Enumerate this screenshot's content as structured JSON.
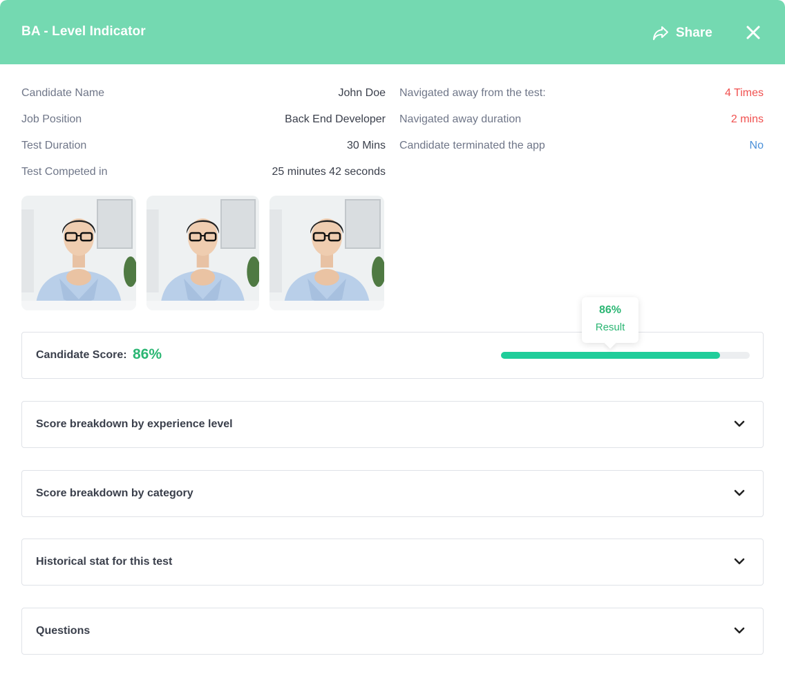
{
  "header": {
    "title": "BA - Level Indicator",
    "share_label": "Share"
  },
  "details_left": [
    {
      "label": "Candidate Name",
      "value": "John Doe"
    },
    {
      "label": "Job Position",
      "value": "Back End Developer"
    },
    {
      "label": "Test Duration",
      "value": "30 Mins"
    },
    {
      "label": "Test Competed in",
      "value": "25 minutes 42 seconds"
    }
  ],
  "details_right": [
    {
      "label": "Navigated away from the test:",
      "value": "4 Times",
      "color": "#f0504f"
    },
    {
      "label": "Navigated away duration",
      "value": "2 mins",
      "color": "#f0504f"
    },
    {
      "label": "Candidate terminated the app",
      "value": "No",
      "color": "#4a90d9"
    }
  ],
  "score": {
    "label": "Candidate Score:",
    "value": "86%",
    "progress_fraction": 0.88,
    "tooltip_value": "86%",
    "tooltip_label": "Result"
  },
  "sections": [
    {
      "title": "Score breakdown by experience level"
    },
    {
      "title": "Score breakdown by category"
    },
    {
      "title": "Historical stat for this test"
    },
    {
      "title": "Questions"
    }
  ],
  "colors": {
    "header": "#74d9b1",
    "accent_green": "#2bb673",
    "progress": "#1fcd9a"
  }
}
